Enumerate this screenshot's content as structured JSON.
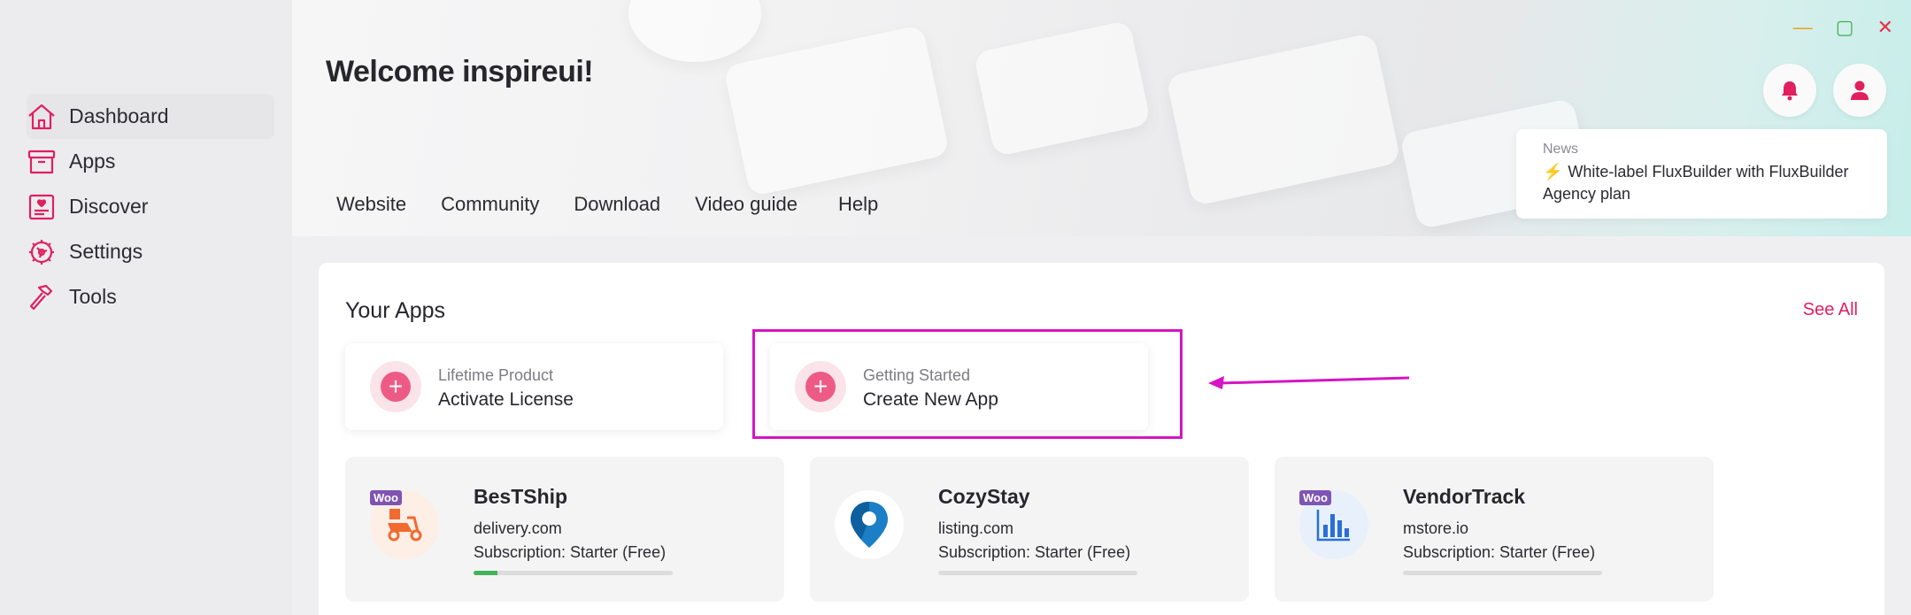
{
  "sidebar": {
    "items": [
      {
        "label": "Dashboard",
        "icon": "home-icon"
      },
      {
        "label": "Apps",
        "icon": "archive-box-icon"
      },
      {
        "label": "Discover",
        "icon": "discover-card-icon"
      },
      {
        "label": "Settings",
        "icon": "gear-icon"
      },
      {
        "label": "Tools",
        "icon": "hammer-icon"
      }
    ]
  },
  "header": {
    "welcome": "Welcome inspireui!",
    "links": [
      "Website",
      "Community",
      "Download",
      "Video guide",
      "Help"
    ],
    "window_controls": {
      "minimize": "—",
      "maximize": "▢",
      "close": "✕"
    }
  },
  "news": {
    "label": "News",
    "text": "White-label FluxBuilder with FluxBuilder Agency plan"
  },
  "main": {
    "section_title": "Your Apps",
    "see_all": "See All",
    "actions": [
      {
        "subtitle": "Lifetime Product",
        "title": "Activate License"
      },
      {
        "subtitle": "Getting Started",
        "title": "Create New App"
      }
    ],
    "apps": [
      {
        "name": "BesTShip",
        "domain": "delivery.com",
        "subscription": "Subscription: Starter (Free)",
        "badge": "Woo",
        "progress": 0.12
      },
      {
        "name": "CozyStay",
        "domain": "listing.com",
        "subscription": "Subscription: Starter (Free)",
        "badge": "",
        "progress": 0
      },
      {
        "name": "VendorTrack",
        "domain": "mstore.io",
        "subscription": "Subscription: Starter (Free)",
        "badge": "Woo",
        "progress": 0
      }
    ]
  },
  "colors": {
    "accent": "#e0205f",
    "highlight": "#d515c4",
    "progress": "#44b35a"
  }
}
